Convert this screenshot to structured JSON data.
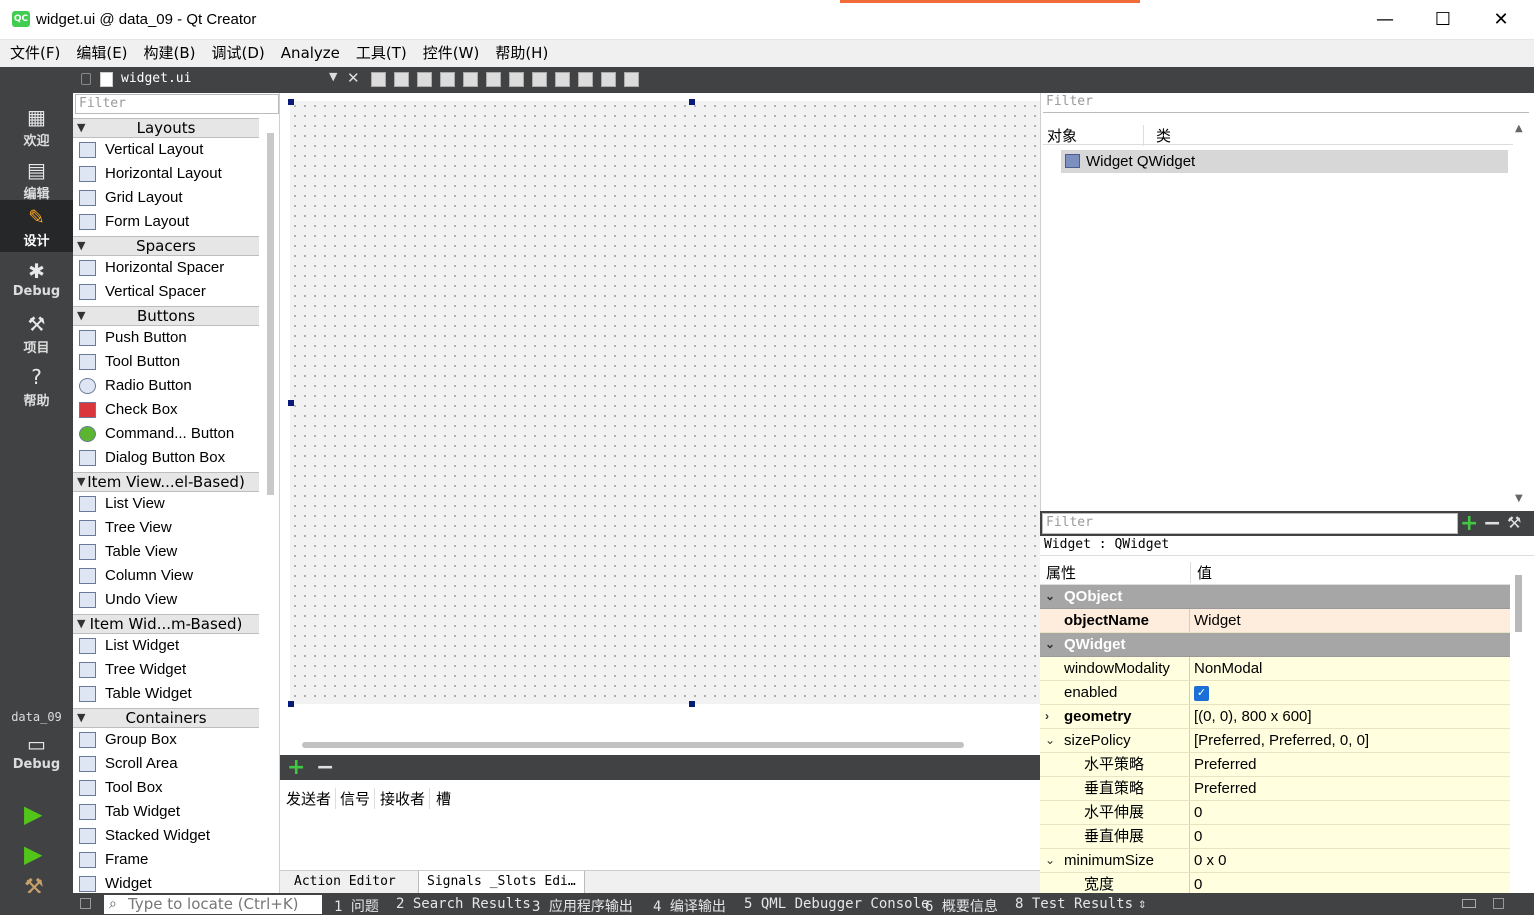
{
  "window": {
    "title": "widget.ui @ data_09 - Qt Creator",
    "app_icon": "QC",
    "minimize": "—",
    "maximize": "☐",
    "close": "✕"
  },
  "menu": [
    "文件(F)",
    "编辑(E)",
    "构建(B)",
    "调试(D)",
    "Analyze",
    "工具(T)",
    "控件(W)",
    "帮助(H)"
  ],
  "modes": [
    {
      "label": "欢迎",
      "icon": "grid-icon"
    },
    {
      "label": "编辑",
      "icon": "document-icon"
    },
    {
      "label": "设计",
      "icon": "pencil-icon"
    },
    {
      "label": "Debug",
      "icon": "bug-icon"
    },
    {
      "label": "项目",
      "icon": "wrench-icon"
    },
    {
      "label": "帮助",
      "icon": "help-icon"
    }
  ],
  "kit": {
    "project": "data_09",
    "mode": "Debug"
  },
  "editor": {
    "filename": "widget.ui"
  },
  "widgetbox": {
    "filter_placeholder": "Filter",
    "categories": [
      {
        "name": "Layouts",
        "items": [
          "Vertical Layout",
          "Horizontal Layout",
          "Grid Layout",
          "Form Layout"
        ]
      },
      {
        "name": "Spacers",
        "items": [
          "Horizontal Spacer",
          "Vertical Spacer"
        ]
      },
      {
        "name": "Buttons",
        "items": [
          "Push Button",
          "Tool Button",
          "Radio Button",
          "Check Box",
          "Command... Button",
          "Dialog Button Box"
        ]
      },
      {
        "name": "Item View...el-Based)",
        "items": [
          "List View",
          "Tree View",
          "Table View",
          "Column View",
          "Undo View"
        ]
      },
      {
        "name": "Item Wid...m-Based)",
        "items": [
          "List Widget",
          "Tree Widget",
          "Table Widget"
        ]
      },
      {
        "name": "Containers",
        "items": [
          "Group Box",
          "Scroll Area",
          "Tool Box",
          "Tab Widget",
          "Stacked Widget",
          "Frame",
          "Widget"
        ]
      }
    ]
  },
  "signals": {
    "headers": [
      "发送者",
      "信号",
      "接收者",
      "槽"
    ],
    "tabs": [
      "Action Editor",
      "Signals _Slots Edi…"
    ]
  },
  "object_inspector": {
    "filter_placeholder": "Filter",
    "headers": [
      "对象",
      "类"
    ],
    "row": {
      "object": "Widget",
      "class": "QWidget"
    }
  },
  "property_editor": {
    "filter_placeholder": "Filter",
    "class_label": "Widget : QWidget",
    "headers": [
      "属性",
      "值"
    ],
    "rows": [
      {
        "type": "group",
        "name": "QObject"
      },
      {
        "type": "obj",
        "name": "objectName",
        "value": "Widget",
        "bold": true
      },
      {
        "type": "group",
        "name": "QWidget"
      },
      {
        "type": "wid",
        "name": "windowModality",
        "value": "NonModal"
      },
      {
        "type": "wid",
        "name": "enabled",
        "value": "✓",
        "checkbox": true
      },
      {
        "type": "wid",
        "name": "geometry",
        "value": "[(0, 0), 800 x 600]",
        "bold": true,
        "expand": "›"
      },
      {
        "type": "wid",
        "name": "sizePolicy",
        "value": "[Preferred, Preferred, 0, 0]",
        "expand": "⌄"
      },
      {
        "type": "sub",
        "name": "水平策略",
        "value": "Preferred"
      },
      {
        "type": "sub",
        "name": "垂直策略",
        "value": "Preferred"
      },
      {
        "type": "sub",
        "name": "水平伸展",
        "value": "0"
      },
      {
        "type": "sub",
        "name": "垂直伸展",
        "value": "0"
      },
      {
        "type": "wid",
        "name": "minimumSize",
        "value": "0 x 0",
        "expand": "⌄"
      },
      {
        "type": "sub",
        "name": "宽度",
        "value": "0"
      }
    ]
  },
  "statusbar": {
    "locator_placeholder": "Type to locate (Ctrl+K)",
    "items": [
      "1 问题",
      "2 Search Results",
      "3 应用程序输出",
      "4 编译输出",
      "5 QML Debugger Console",
      "6 概要信息",
      "8 Test Results"
    ],
    "toggle": "⇕"
  }
}
